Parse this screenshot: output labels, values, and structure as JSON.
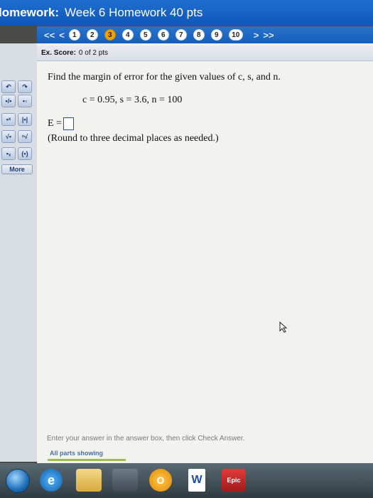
{
  "header": {
    "prefix": "lomework:",
    "title": "Week 6 Homework 40 pts"
  },
  "nav": {
    "first_label": "<<",
    "prev_label": "<",
    "next_label": ">",
    "last_label": ">>",
    "questions": [
      "1",
      "2",
      "3",
      "4",
      "5",
      "6",
      "7",
      "8",
      "9",
      "10"
    ],
    "current": "3"
  },
  "toolbar": {
    "buttons": [
      [
        "undo",
        "redo"
      ],
      [
        "fraction",
        "mixed"
      ],
      [
        "exponent",
        "abs"
      ],
      [
        "sqrt",
        "nthroot"
      ],
      [
        "subscript",
        "paren"
      ]
    ],
    "more_label": "More"
  },
  "score": {
    "label": "Ex. Score:",
    "value": "0 of 2 pts"
  },
  "problem": {
    "question": "Find the margin of error for the given values of c, s, and n.",
    "values": "c = 0.95, s = 3.6, n = 100",
    "answer_label": "E =",
    "answer_value": "",
    "instruction": "(Round to three decimal places as needed.)"
  },
  "footer": {
    "instruction": "Enter your answer in the answer box, then click Check Answer.",
    "parts_label": "All parts showing"
  },
  "taskbar": {
    "word_label": "W",
    "app_label": "Epic",
    "orange_label": "O"
  },
  "colors": {
    "titlebar": "#1565c8",
    "current_question": "#f0a000",
    "parts_bar": "#9fbe52"
  }
}
